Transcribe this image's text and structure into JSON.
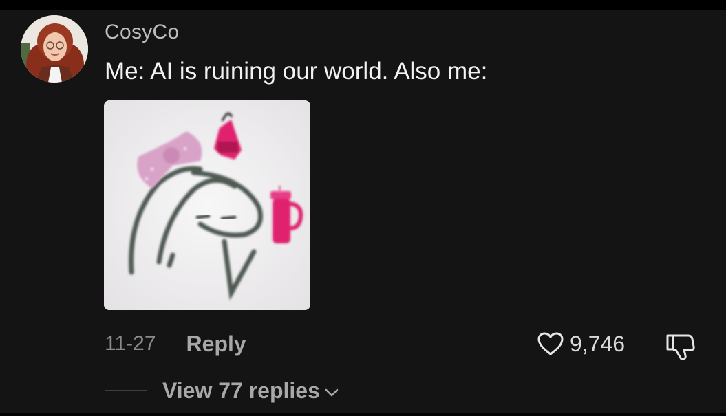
{
  "comment": {
    "username": "CosyCo",
    "text": "Me: AI is ruining our world. Also me:",
    "date": "11-27",
    "reply_label": "Reply",
    "like_count": "9,746",
    "view_replies_label": "View 77 replies"
  },
  "icons": {
    "like": "heart-outline-icon",
    "dislike": "thumbs-down-outline-icon",
    "expand": "chevron-down-icon"
  },
  "colors": {
    "background": "#141414",
    "primary_text": "#f2f2f2",
    "secondary_text": "#a8a8a8",
    "accent_pink": "#e0236e"
  }
}
